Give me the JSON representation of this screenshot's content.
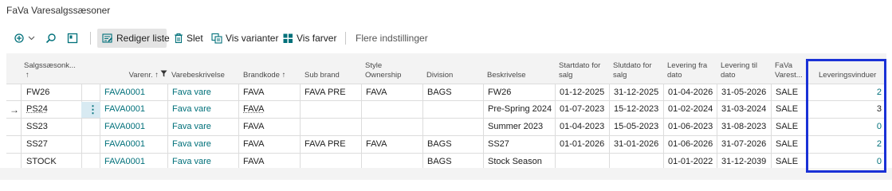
{
  "page": {
    "title": "FaVa Varesalgssæsoner"
  },
  "toolbar": {
    "edit_list": "Rediger liste",
    "delete": "Slet",
    "show_variants": "Vis varianter",
    "show_colors": "Vis farver",
    "more_options": "Flere indstillinger"
  },
  "columns": {
    "season_code": "Salgssæsonk...",
    "season_sort": "↑",
    "item_no": "Varenr. ↑",
    "description": "Varebeskrivelse",
    "brand": "Brandkode ↑",
    "sub_brand": "Sub brand",
    "style_ownership_1": "Style",
    "style_ownership_2": "Ownership",
    "division": "Division",
    "beskrivelse": "Beskrivelse",
    "start_date_1": "Startdato for",
    "start_date_2": "salg",
    "end_date_1": "Slutdato for",
    "end_date_2": "salg",
    "delivery_from_1": "Levering fra",
    "delivery_from_2": "dato",
    "delivery_to_1": "Levering til",
    "delivery_to_2": "dato",
    "fava_1": "FaVa",
    "fava_2": "Varest...",
    "delivery_windows": "Leveringsvinduer"
  },
  "rows": [
    {
      "season": "FW26",
      "item": "FAVA0001",
      "desc": "Fava vare",
      "brand": "FAVA",
      "sub_brand": "FAVA PRE",
      "ownership": "FAVA",
      "division": "BAGS",
      "beskrivelse": "FW26",
      "start": "01-12-2025",
      "end": "31-12-2025",
      "dfrom": "01-04-2026",
      "dto": "31-05-2026",
      "status": "SALE",
      "windows": "2"
    },
    {
      "season": "PS24",
      "item": "FAVA0001",
      "desc": "Fava vare",
      "brand": "FAVA",
      "sub_brand": "",
      "ownership": "",
      "division": "",
      "beskrivelse": "Pre-Spring 2024",
      "start": "01-07-2023",
      "end": "15-12-2023",
      "dfrom": "01-02-2024",
      "dto": "31-03-2024",
      "status": "SALE",
      "windows": "3"
    },
    {
      "season": "SS23",
      "item": "FAVA0001",
      "desc": "Fava vare",
      "brand": "FAVA",
      "sub_brand": "",
      "ownership": "",
      "division": "",
      "beskrivelse": "Summer 2023",
      "start": "01-04-2023",
      "end": "15-05-2023",
      "dfrom": "01-06-2023",
      "dto": "31-08-2023",
      "status": "SALE",
      "windows": "0"
    },
    {
      "season": "SS27",
      "item": "FAVA0001",
      "desc": "Fava vare",
      "brand": "FAVA",
      "sub_brand": "FAVA PRE",
      "ownership": "FAVA",
      "division": "BAGS",
      "beskrivelse": "SS27",
      "start": "01-01-2026",
      "end": "31-01-2026",
      "dfrom": "01-06-2026",
      "dto": "31-07-2026",
      "status": "SALE",
      "windows": "2"
    },
    {
      "season": "STOCK",
      "item": "FAVA0001",
      "desc": "Fava vare",
      "brand": "FAVA",
      "sub_brand": "",
      "ownership": "",
      "division": "BAGS",
      "beskrivelse": "Stock Season",
      "start": "",
      "end": "",
      "dfrom": "01-01-2022",
      "dto": "31-12-2039",
      "status": "SALE",
      "windows": "0"
    }
  ],
  "colors": {
    "link": "#00707a",
    "highlight": "#1a31d6"
  },
  "icons": {
    "new": "new-record-icon",
    "search": "search-icon",
    "view": "view-icon",
    "edit": "edit-list-icon",
    "delete": "trash-icon",
    "variants": "variants-icon",
    "colors": "grid-icon",
    "filter": "filter-icon",
    "row_actions": "kebab-icon",
    "current_row": "arrow-right-icon"
  }
}
